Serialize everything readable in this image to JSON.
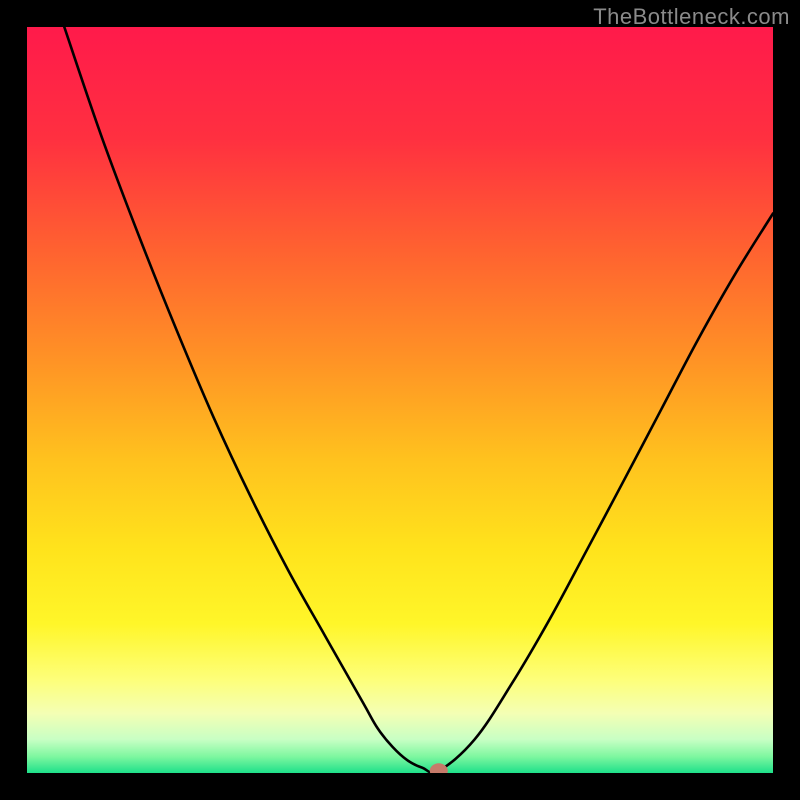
{
  "watermark": "TheBottleneck.com",
  "chart_data": {
    "type": "line",
    "title": "",
    "xlabel": "",
    "ylabel": "",
    "xlim": [
      0,
      1
    ],
    "ylim": [
      0,
      1
    ],
    "series": [
      {
        "name": "bottleneck-curve",
        "x": [
          0.05,
          0.1,
          0.15,
          0.2,
          0.25,
          0.3,
          0.35,
          0.4,
          0.45,
          0.47,
          0.49,
          0.51,
          0.53,
          0.552,
          0.6,
          0.65,
          0.7,
          0.75,
          0.8,
          0.85,
          0.9,
          0.95,
          1.0
        ],
        "values": [
          1.0,
          0.853,
          0.72,
          0.595,
          0.477,
          0.37,
          0.272,
          0.183,
          0.095,
          0.06,
          0.035,
          0.017,
          0.007,
          0.003,
          0.045,
          0.12,
          0.205,
          0.298,
          0.392,
          0.487,
          0.582,
          0.67,
          0.75
        ]
      }
    ],
    "marker": {
      "x": 0.552,
      "y": 0.003,
      "name": "min-point",
      "color": "#c67a6a"
    },
    "background_gradient": {
      "stops": [
        {
          "pos": 0.0,
          "color": "#ff1a4b"
        },
        {
          "pos": 0.15,
          "color": "#ff3040"
        },
        {
          "pos": 0.3,
          "color": "#ff6230"
        },
        {
          "pos": 0.45,
          "color": "#ff9425"
        },
        {
          "pos": 0.58,
          "color": "#ffc21e"
        },
        {
          "pos": 0.7,
          "color": "#ffe31c"
        },
        {
          "pos": 0.8,
          "color": "#fff629"
        },
        {
          "pos": 0.875,
          "color": "#fdff7a"
        },
        {
          "pos": 0.92,
          "color": "#f4ffb4"
        },
        {
          "pos": 0.955,
          "color": "#c8ffc4"
        },
        {
          "pos": 0.978,
          "color": "#7ef7a0"
        },
        {
          "pos": 1.0,
          "color": "#1ee08a"
        }
      ]
    }
  }
}
